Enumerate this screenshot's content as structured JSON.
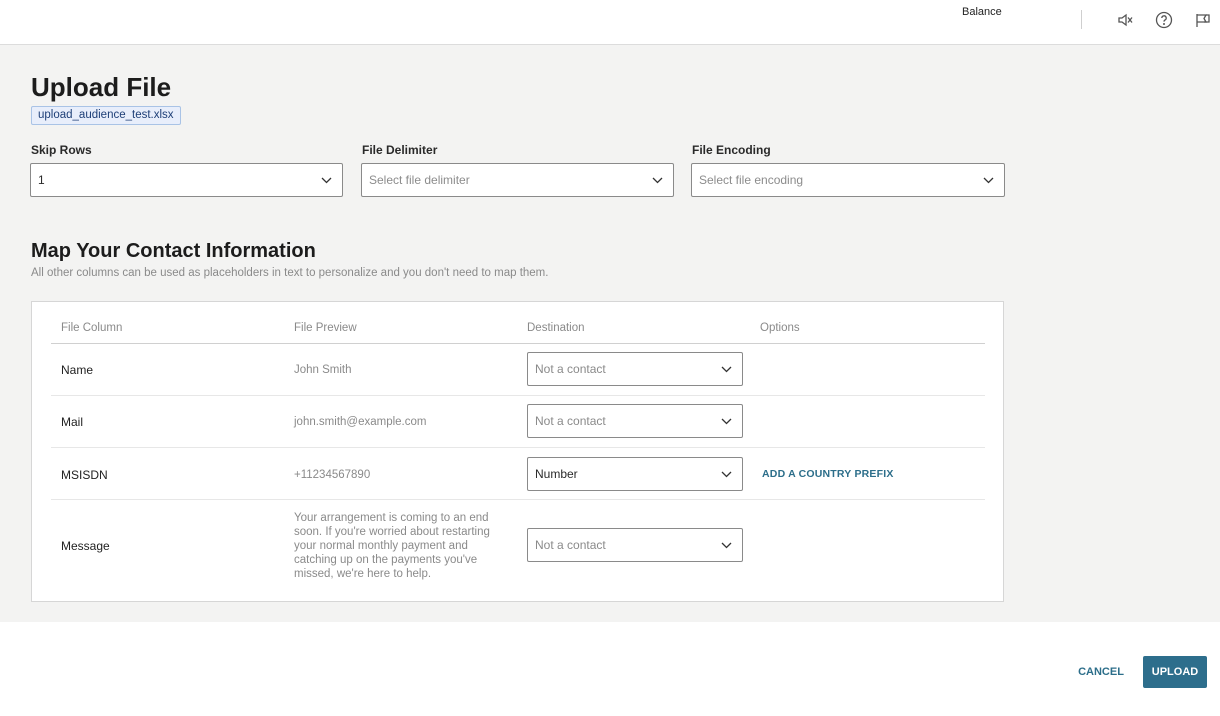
{
  "header": {
    "balance_label": "Balance",
    "icons": [
      "sound-off-icon",
      "help-icon",
      "announcement-icon"
    ]
  },
  "page": {
    "title": "Upload File",
    "file_name": "upload_audience_test.xlsx"
  },
  "settings": {
    "skip_rows": {
      "label": "Skip Rows",
      "value": "1"
    },
    "file_delimiter": {
      "label": "File Delimiter",
      "placeholder": "Select file delimiter"
    },
    "file_encoding": {
      "label": "File Encoding",
      "placeholder": "Select file encoding"
    }
  },
  "mapping": {
    "title": "Map Your Contact Information",
    "subtitle": "All other columns can be used as placeholders in text to personalize and you don't need to map them.",
    "columns": [
      "File Column",
      "File Preview",
      "Destination",
      "Options"
    ],
    "rows": [
      {
        "name": "Name",
        "preview": "John Smith",
        "destination": "Not a contact",
        "option": ""
      },
      {
        "name": "Mail",
        "preview": "john.smith@example.com",
        "destination": "Not a contact",
        "option": ""
      },
      {
        "name": "MSISDN",
        "preview": "+11234567890",
        "destination": "Number",
        "option": "ADD A COUNTRY PREFIX"
      },
      {
        "name": "Message",
        "preview": "Your arrangement is coming to an end soon. If you're worried about restarting your normal monthly payment and catching up on the payments you've missed, we're here to help.",
        "destination": "Not a contact",
        "option": ""
      }
    ]
  },
  "footer": {
    "cancel_label": "CANCEL",
    "upload_label": "UPLOAD"
  },
  "colors": {
    "accent": "#2d6e8c",
    "chip_bg": "#e8eefb",
    "chip_border": "#a9c3e6",
    "page_bg": "#f3f3f2"
  }
}
